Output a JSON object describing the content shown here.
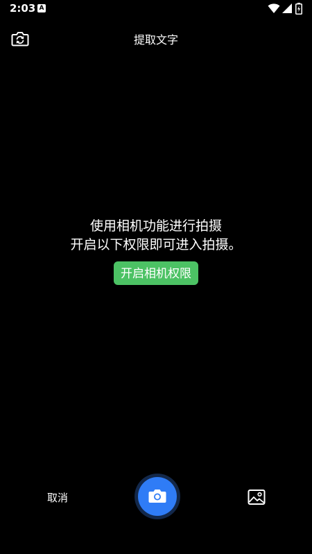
{
  "status_bar": {
    "time": "2:03",
    "notification_badge": "A",
    "icons": [
      "wifi-icon",
      "cellular-signal-icon",
      "battery-icon"
    ]
  },
  "header": {
    "title": "提取文字",
    "flip_camera_icon": "flip-camera-icon"
  },
  "permission_prompt": {
    "line1": "使用相机功能进行拍摄",
    "line2": "开启以下权限即可进入拍摄。",
    "button_label": "开启相机权限",
    "button_color": "#4cc264"
  },
  "bottom_bar": {
    "cancel_label": "取消",
    "shutter_icon": "camera-icon",
    "shutter_color": "#2f7cf6",
    "gallery_icon": "image-gallery-icon"
  }
}
